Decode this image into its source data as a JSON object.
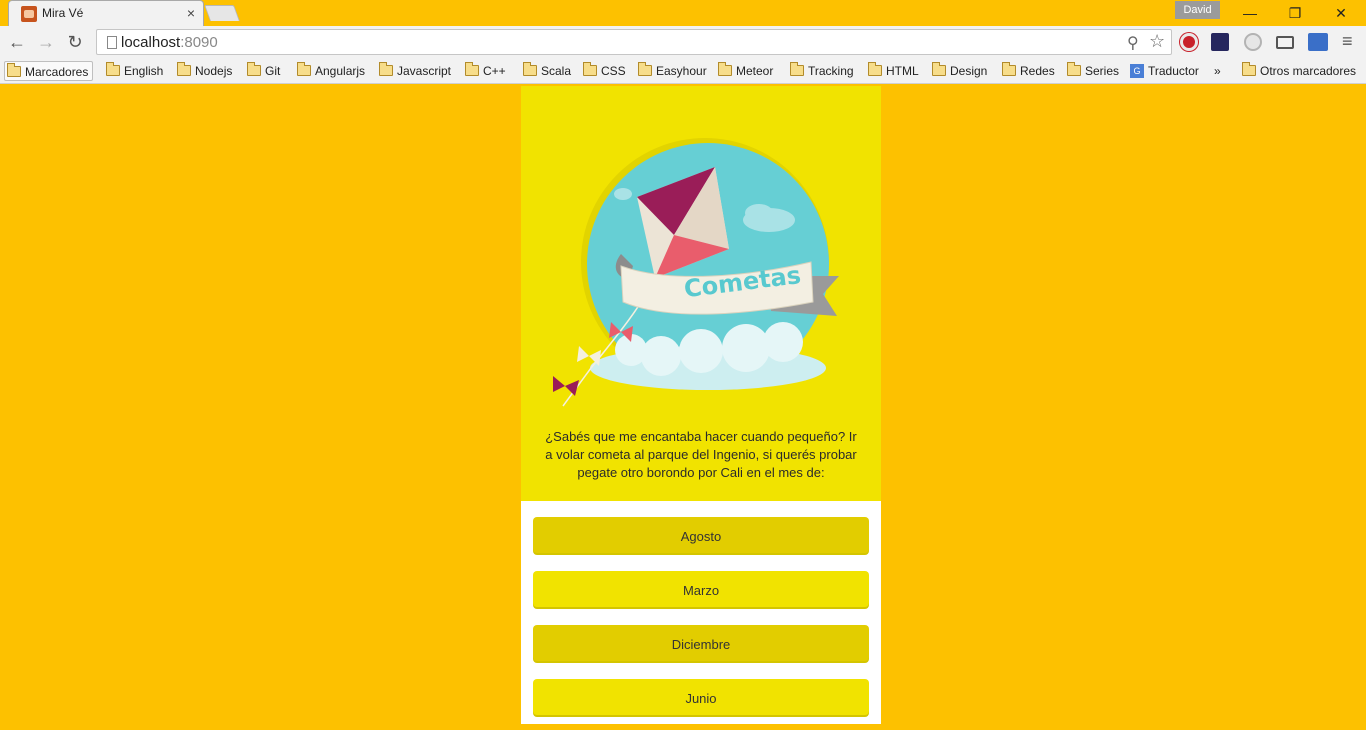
{
  "browser": {
    "tab_title": "Mira Vé",
    "tab_close": "×",
    "profile_name": "David",
    "window_controls": {
      "minimize": "—",
      "restore": "❐",
      "close": "✕"
    },
    "url_host": "localhost",
    "url_port": ":8090",
    "nav": {
      "back": "←",
      "forward": "→",
      "reload": "↻"
    },
    "omnibox_icons": {
      "zoom": "⚲",
      "star": "☆"
    },
    "menu": "≡"
  },
  "bookmarks": [
    {
      "label": "Marcadores",
      "icon": "folder-icon"
    },
    {
      "label": "English",
      "icon": "folder-icon"
    },
    {
      "label": "Nodejs",
      "icon": "folder-icon"
    },
    {
      "label": "Git",
      "icon": "folder-icon"
    },
    {
      "label": "Angularjs",
      "icon": "folder-icon"
    },
    {
      "label": "Javascript",
      "icon": "folder-icon"
    },
    {
      "label": "C++",
      "icon": "folder-icon"
    },
    {
      "label": "Scala",
      "icon": "folder-icon"
    },
    {
      "label": "CSS",
      "icon": "folder-icon"
    },
    {
      "label": "Easyhour",
      "icon": "folder-icon"
    },
    {
      "label": "Meteor",
      "icon": "folder-icon"
    },
    {
      "label": "Tracking",
      "icon": "folder-icon"
    },
    {
      "label": "HTML",
      "icon": "folder-icon"
    },
    {
      "label": "Design",
      "icon": "folder-icon"
    },
    {
      "label": "Redes",
      "icon": "folder-icon"
    },
    {
      "label": "Series",
      "icon": "folder-icon"
    },
    {
      "label": "Traductor",
      "icon": "google-translate-icon"
    }
  ],
  "bookmarks_overflow": "»",
  "bookmarks_other": "Otros marcadores",
  "page": {
    "logo_text": "Cometas",
    "intro": "¿Sabés que me encantaba hacer cuando pequeño? Ir a volar cometa al parque del Ingenio, si querés probar pegate otro borondo por Cali en el mes de:",
    "options": [
      "Agosto",
      "Marzo",
      "Diciembre",
      "Junio"
    ]
  },
  "colors": {
    "page_background": "#fdc100",
    "card_background": "#f1e300",
    "option_dark": "#e2cd00",
    "option_light": "#f1e300",
    "sky_circle": "#66cfd4"
  }
}
